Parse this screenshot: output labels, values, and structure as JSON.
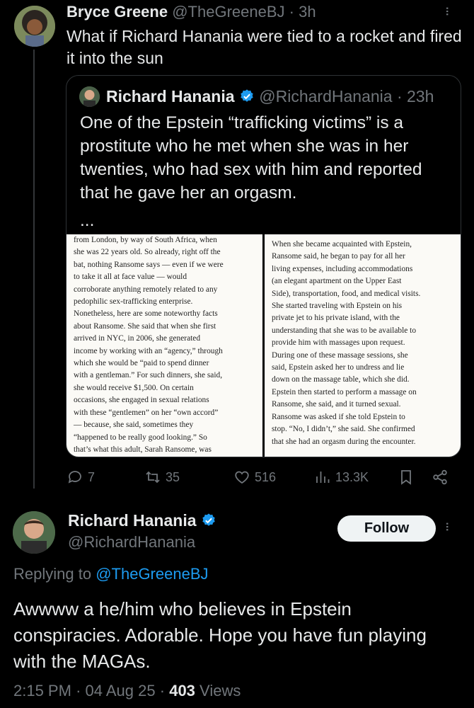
{
  "tweet1": {
    "author_name": "Bryce Greene",
    "author_handle": "@TheGreeneBJ",
    "time": "· 3h",
    "text": "What if Richard Hanania were tied to a rocket and fired it into the sun",
    "quote": {
      "author_name": "Richard Hanania",
      "author_handle": "@RichardHanania",
      "time": "· 23h",
      "text": "One of the Epstein “trafficking victims” is a prostitute who he met when she was in her twenties, who had sex with him and reported that he gave her an orgasm.",
      "ellipsis": "...",
      "image_left_lines": [
        "from London, by way of South Africa, when",
        "she was 22 years old. So already, right off the",
        "bat, nothing Ransome says — even if we were",
        "to take it all at face value — would",
        "corroborate anything remotely related to any",
        "pedophilic sex-trafficking enterprise.",
        "Nonetheless, here are some noteworthy facts",
        "about Ransome. She said that when she first",
        "arrived in NYC, in 2006, she generated",
        "income by working with an “agency,” through",
        "which she would be “paid to spend dinner",
        "with a gentleman.” For such dinners, she said,",
        "she would receive $1,500. On certain",
        "occasions, she engaged in sexual relations",
        "with these “gentlemen” on her “own accord”",
        "— because, she said, sometimes they",
        "“happened to be really good looking.” So",
        "that’s what this adult, Sarah Ransome, was"
      ],
      "image_right_lines": [
        "When she became acquainted with Epstein,",
        "Ransome said, he began to pay for all her",
        "living expenses, including accommodations",
        "(an elegant apartment on the Upper East",
        "Side), transportation, food, and medical visits.",
        "She started traveling with Epstein on his",
        "private jet to his private island, with the",
        "understanding that she was to be available to",
        "provide him with massages upon request.",
        "During one of these massage sessions, she",
        "said, Epstein asked her to undress and lie",
        "down on the massage table, which she did.",
        "Epstein then started to perform a massage on",
        "Ransome, she said, and it turned sexual.",
        "Ransome was asked if she told Epstein to",
        "stop. “No, I didn’t,” she said. She confirmed",
        "that she had an orgasm during the encounter."
      ]
    },
    "actions": {
      "replies": "7",
      "reposts": "35",
      "likes": "516",
      "views": "13.3K"
    }
  },
  "tweet2": {
    "author_name": "Richard Hanania",
    "author_handle": "@RichardHanania",
    "follow_label": "Follow",
    "replying_prefix": "Replying to",
    "replying_to": "@TheGreeneBJ",
    "text": "Awwww a he/him who believes in Epstein conspiracies. Adorable. Hope you have fun playing with the MAGAs.",
    "time": "2:15 PM",
    "date": "04 Aug 25",
    "views_count": "403",
    "views_label": "Views"
  },
  "colors": {
    "background": "#000000",
    "text": "#e7e9ea",
    "muted": "#71767b",
    "accent": "#1d9bf0",
    "border": "#2f3336"
  },
  "icons": [
    "more-icon",
    "verified-icon",
    "reply-icon",
    "repost-icon",
    "like-icon",
    "views-icon",
    "bookmark-icon",
    "share-icon"
  ]
}
